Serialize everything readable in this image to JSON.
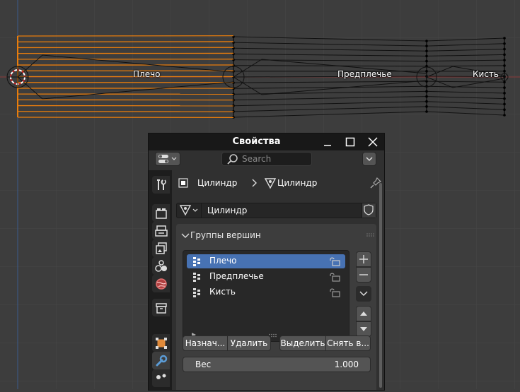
{
  "viewport": {
    "bone_labels": [
      "Плечо",
      "Предплечье",
      "Кисть"
    ]
  },
  "window": {
    "title": "Свойства"
  },
  "header": {
    "search_placeholder": "Search"
  },
  "breadcrumb": {
    "object_name": "Цилиндр",
    "mesh_name": "Цилиндр"
  },
  "mesh_data": {
    "name": "Цилиндр"
  },
  "vertex_groups": {
    "title": "Группы вершин",
    "items": [
      "Плечо",
      "Предплечье",
      "Кисть"
    ],
    "selected_index": 0,
    "buttons": {
      "assign": "Назнач...",
      "remove": "Удалить",
      "select": "Выделить",
      "deselect": "Снять в..."
    },
    "weight_label": "Вес",
    "weight_value": "1.000"
  },
  "colors": {
    "selected_wire": "#e87d0d",
    "selected_row": "#4772b3",
    "background": "#3d3d3d"
  },
  "sidebar_icons": [
    "tool-icon",
    "render-icon",
    "output-icon",
    "view-layer-icon",
    "scene-icon",
    "world-icon",
    "collection-icon",
    "object-icon",
    "modifier-icon",
    "particles-icon"
  ]
}
